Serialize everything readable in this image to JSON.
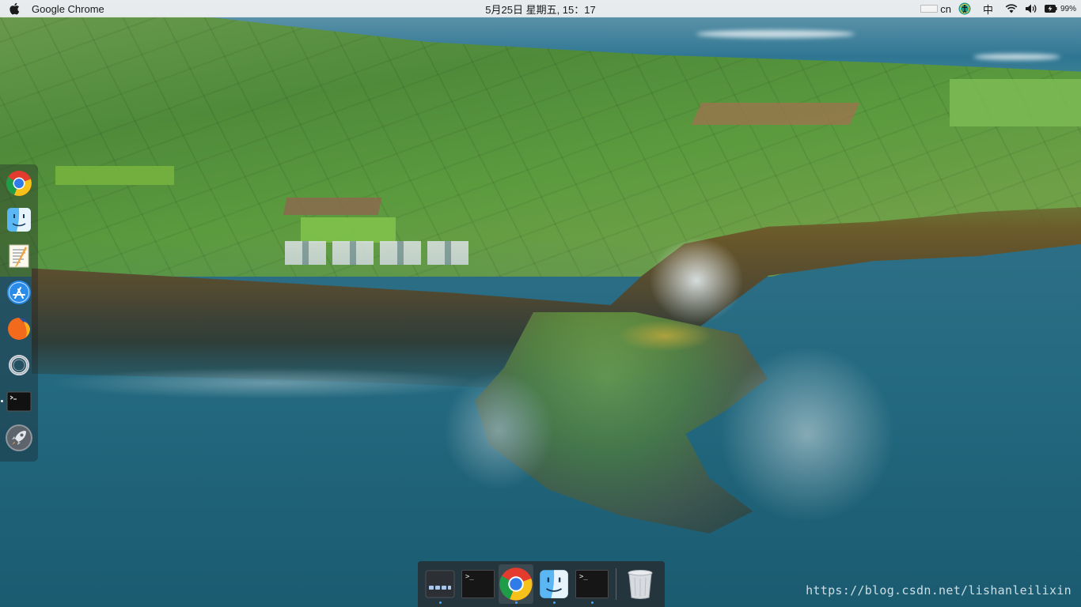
{
  "menubar": {
    "app_name": "Google Chrome",
    "clock": "5月25日 星期五, 15：17",
    "input_method": "cn",
    "ime_label": "中",
    "battery": "99%"
  },
  "left_dock": {
    "items": [
      {
        "name": "chrome",
        "running": false
      },
      {
        "name": "finder",
        "running": false
      },
      {
        "name": "textedit",
        "running": false
      },
      {
        "name": "app-store",
        "running": false
      },
      {
        "name": "firefox",
        "running": false
      },
      {
        "name": "ring-app",
        "running": false
      },
      {
        "name": "terminal",
        "running": true
      },
      {
        "name": "launchpad",
        "running": false
      }
    ]
  },
  "bottom_dock": {
    "items": [
      {
        "name": "window-switcher",
        "running": true
      },
      {
        "name": "terminal",
        "running": false
      },
      {
        "name": "chrome",
        "running": true
      },
      {
        "name": "finder",
        "running": true
      },
      {
        "name": "terminal-2",
        "running": true
      },
      {
        "name": "trash",
        "running": false
      }
    ]
  },
  "watermark": "https://blog.csdn.net/lishanleilixin",
  "colors": {
    "menubar_bg": "#eceef0",
    "dock_bg": "#282a2e",
    "running_dot": "#4aa3ff"
  }
}
